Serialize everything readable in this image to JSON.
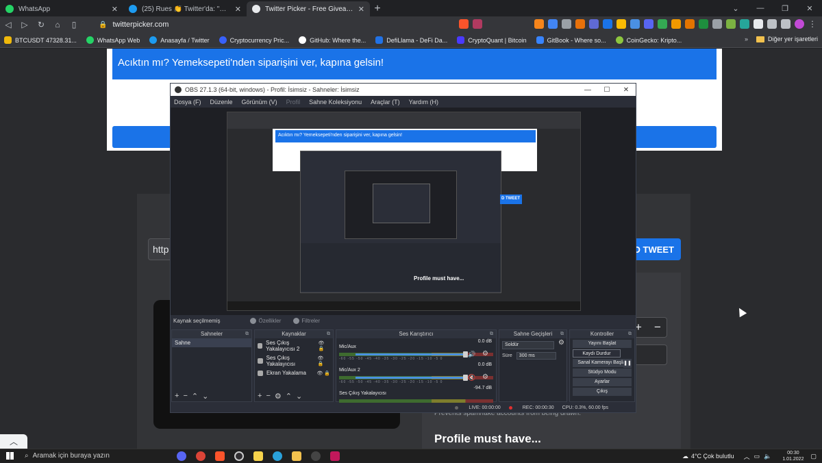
{
  "browser": {
    "tabs": [
      {
        "title": "WhatsApp",
        "favicon_color": "#25d366",
        "active": false
      },
      {
        "title": "(25) Rues 👏 Twitter'da: \"Selamlar... Su",
        "favicon_color": "#1d9bf0",
        "active": false
      },
      {
        "title": "Twitter Picker - Free Giveaway Pic",
        "favicon_color": "#ffffff",
        "active": true
      }
    ],
    "url": "twitterpicker.com",
    "bookmarks": [
      {
        "label": "BTCUSDT 47328.31...",
        "color": "#f0b90b"
      },
      {
        "label": "WhatsApp Web",
        "color": "#25d366"
      },
      {
        "label": "Anasayfa / Twitter",
        "color": "#1d9bf0"
      },
      {
        "label": "Cryptocurrency Pric...",
        "color": "#3861fb"
      },
      {
        "label": "GitHub: Where the...",
        "color": "#ffffff"
      },
      {
        "label": "DefiLlama - DeFi Da...",
        "color": "#2172e5"
      },
      {
        "label": "CryptoQuant | Bitcoin",
        "color": "#4a3aff"
      },
      {
        "label": "GitBook - Where so...",
        "color": "#3884ff"
      },
      {
        "label": "CoinGecko: Kripto...",
        "color": "#8dc63f"
      }
    ],
    "other_bookmarks": "Diğer yer işaretleri"
  },
  "page": {
    "banner_text": "Acıktın mı? Yemeksepeti'nden siparişini ver, kapına gelsin!",
    "url_input_value": "http",
    "add_tweet_label": "D TWEET",
    "prevents_text": "Prevents spam/fake accounts from being drawn.",
    "profile_must_have": "Profile must have..."
  },
  "obs": {
    "title": "OBS 27.1.3 (64-bit, windows) - Profil: İsimsiz - Sahneler: İsimsiz",
    "menu": [
      "Dosya (F)",
      "Düzenle",
      "Görünüm (V)",
      "Profil",
      "Sahne Koleksiyonu",
      "Araçlar (T)",
      "Yardım (H)"
    ],
    "no_source_selected": "Kaynak seçilmemiş",
    "properties_label": "Özellikler",
    "filters_label": "Filtreler",
    "nested_banner": "Acıktın mı? Yemeksepeti'nden siparişini ver, kapına gelsin!",
    "nested_tweet": "D TWEET",
    "nested_profile": "Profile must have...",
    "docks": {
      "scenes": {
        "title": "Sahneler",
        "items": [
          "Sahne"
        ]
      },
      "sources": {
        "title": "Kaynaklar",
        "items": [
          "Ses Çıkış Yakalayıcısı 2",
          "Ses Çıkış Yakalayıcısı",
          "Ekran Yakalama"
        ]
      },
      "mixer": {
        "title": "Ses Karıştırıcı",
        "channels": [
          {
            "name": "Mic/Aux",
            "db": "0.0 dB",
            "muted": false
          },
          {
            "name": "Mic/Aux 2",
            "db": "0.0 dB",
            "muted": true
          },
          {
            "name": "Ses Çıkış Yakalayıcısı",
            "db": "-94.7 dB",
            "muted": false
          }
        ],
        "scale": "-60 -55 -50 -45 -40 -35 -30 -25 -20 -15 -10 -5 0"
      },
      "transitions": {
        "title": "Sahne Geçişleri",
        "selected": "Soldür",
        "duration_label": "Süre",
        "duration_value": "300 ms"
      },
      "controls": {
        "title": "Kontroller",
        "buttons": [
          "Yayını Başlat",
          "Kaydı Durdur",
          "Sanal Kamerayı Başlat",
          "Stüdyo Modu",
          "Ayarlar",
          "Çıkış"
        ]
      }
    },
    "status": {
      "live": "LIVE: 00:00:00",
      "rec": "REC: 00:00:30",
      "cpu": "CPU: 0.3%, 60.00 fps"
    }
  },
  "taskbar": {
    "search_placeholder": "Aramak için buraya yazın",
    "weather": "4°C  Çok bulutlu",
    "time": "00:30",
    "date": "1.01.2022"
  }
}
